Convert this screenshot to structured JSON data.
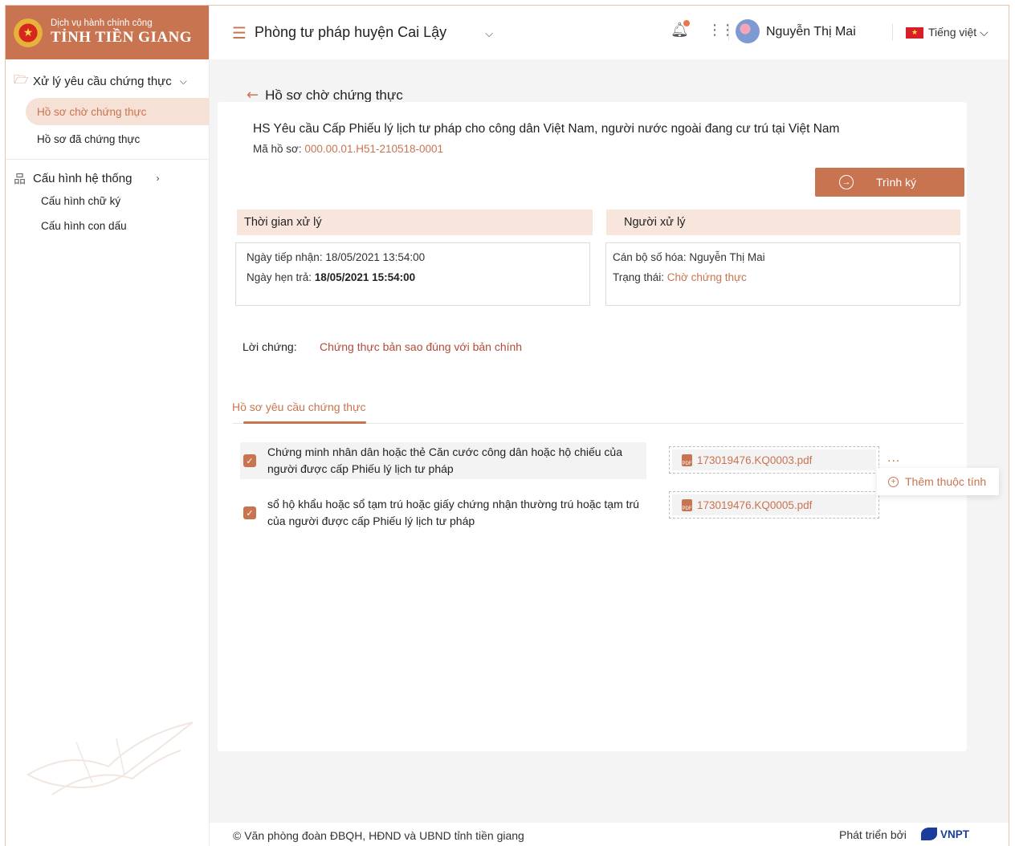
{
  "brand": {
    "subtitle": "Dịch vụ hành chính công",
    "title": "TỈNH TIỀN GIANG"
  },
  "sidebar": {
    "group1": {
      "label": "Xử lý yêu cầu chứng thực",
      "items": [
        {
          "label": "Hồ sơ chờ chứng thực",
          "active": true
        },
        {
          "label": "Hồ sơ đã chứng thực",
          "active": false
        }
      ]
    },
    "group2": {
      "label": "Cấu hình hệ thống",
      "items": [
        {
          "label": "Cấu hình chữ ký"
        },
        {
          "label": "Cấu hình con dấu"
        }
      ]
    }
  },
  "header": {
    "unit": "Phòng tư pháp huyện Cai Lậy",
    "user": "Nguyễn Thị Mai",
    "language": "Tiếng việt"
  },
  "page": {
    "title": "Hồ sơ chờ chứng thực",
    "request_title": "HS Yêu cầu Cấp Phiếu lý lịch tư pháp cho công dân Việt Nam, người nước ngoài đang cư trú tại Việt Nam",
    "code_label": "Mã hồ sơ: ",
    "code_value": "000.00.01.H51-210518-0001",
    "sign_button": "Trình ký"
  },
  "time_panel": {
    "heading": "Thời gian xử lý",
    "received_label": "Ngày tiếp nhận: ",
    "received_value": "18/05/2021 13:54:00",
    "due_label": "Ngày hẹn trả: ",
    "due_value": "18/05/2021 15:54:00"
  },
  "handler_panel": {
    "heading": "Người xử lý",
    "officer_label": "Cán bộ số hóa: ",
    "officer_value": "Nguyễn Thị Mai",
    "status_label": "Trạng thái: ",
    "status_value": "Chờ chứng thực"
  },
  "attestation": {
    "label": "Lời chứng:",
    "value": "Chứng thực bản sao đúng với bản chính"
  },
  "tabs": {
    "active": "Hồ sơ yêu cầu chứng thực"
  },
  "documents": [
    {
      "checked": true,
      "text": "Chứng minh nhân dân hoặc thẻ Căn cước công dân hoặc hộ chiếu của người được cấp Phiếu lý lịch tư pháp",
      "file": "173019476.KQ0003.pdf"
    },
    {
      "checked": true,
      "text": "sổ hộ khẩu hoặc sổ tạm trú hoặc giấy chứng nhận thường trú hoặc tạm trú của người được cấp Phiếu lý lịch tư pháp",
      "file": "173019476.KQ0005.pdf"
    }
  ],
  "more_menu": {
    "dots": "...",
    "add_attribute": "Thêm thuộc tính"
  },
  "footer": {
    "copyright": "© Văn phòng đoàn ĐBQH, HĐND và UBND tỉnh tiền giang",
    "developed_by": "Phát triển bởi",
    "company": "VNPT"
  },
  "colors": {
    "accent": "#c97451",
    "accent_light": "#f8e6dd",
    "link_red": "#b34b3a"
  }
}
